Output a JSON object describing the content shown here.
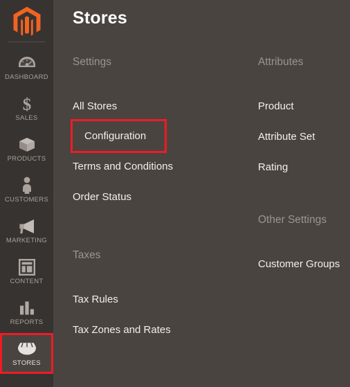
{
  "page": {
    "title": "Stores"
  },
  "sidebar": {
    "logo_name": "magento-logo",
    "items": [
      {
        "label": "DASHBOARD",
        "icon": "dashboard-gauge-icon"
      },
      {
        "label": "SALES",
        "icon": "dollar-sign-icon"
      },
      {
        "label": "PRODUCTS",
        "icon": "box-package-icon"
      },
      {
        "label": "CUSTOMERS",
        "icon": "person-icon"
      },
      {
        "label": "MARKETING",
        "icon": "megaphone-icon"
      },
      {
        "label": "CONTENT",
        "icon": "page-layout-icon"
      },
      {
        "label": "REPORTS",
        "icon": "bar-chart-icon"
      },
      {
        "label": "STORES",
        "icon": "store-awning-icon"
      }
    ],
    "active_item": "STORES",
    "highlight_item": "STORES"
  },
  "menu": {
    "left_column": {
      "settings": {
        "heading": "Settings",
        "links": [
          "All Stores",
          "Configuration",
          "Terms and Conditions",
          "Order Status"
        ],
        "highlighted_link": "Configuration"
      },
      "taxes": {
        "heading": "Taxes",
        "links": [
          "Tax Rules",
          "Tax Zones and Rates"
        ]
      }
    },
    "right_column": {
      "attributes": {
        "heading": "Attributes",
        "links": [
          "Product",
          "Attribute Set",
          "Rating"
        ]
      },
      "other_settings": {
        "heading": "Other Settings",
        "links": [
          "Customer Groups"
        ]
      }
    }
  },
  "colors": {
    "sidebar_bg": "#373330",
    "content_bg": "#4a4441",
    "brand_orange": "#f26322",
    "highlight_red": "#ee1c25",
    "link_text": "#f2efec",
    "heading_text": "#9b9590"
  }
}
